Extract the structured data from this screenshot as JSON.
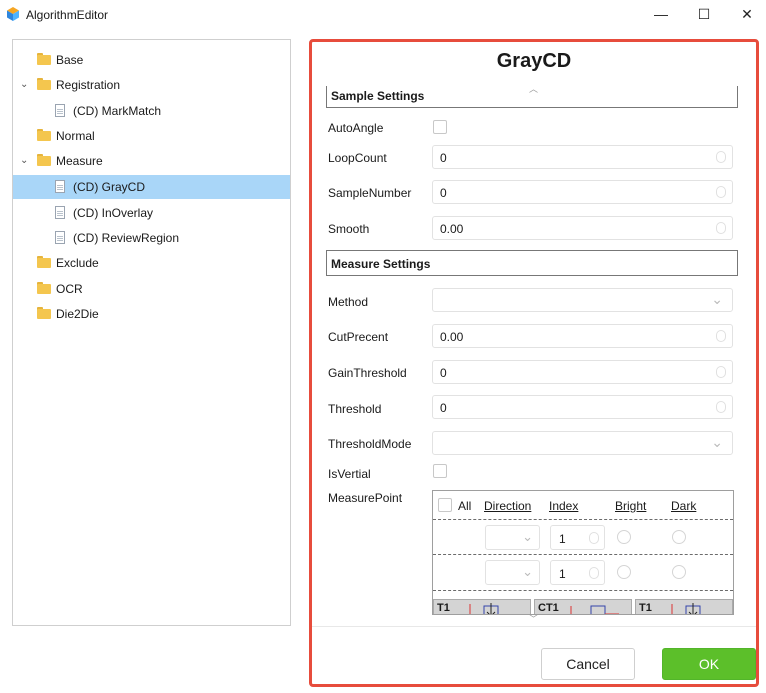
{
  "window": {
    "title": "AlgorithmEditor",
    "minimize": "—",
    "maximize": "☐",
    "close": "✕"
  },
  "tree": {
    "items": [
      {
        "label": "Base",
        "type": "folder",
        "level": 0,
        "expanded": false,
        "selected": false
      },
      {
        "label": "Registration",
        "type": "folder",
        "level": 0,
        "expanded": true,
        "selected": false
      },
      {
        "label": "(CD) MarkMatch",
        "type": "file",
        "level": 1,
        "selected": false
      },
      {
        "label": "Normal",
        "type": "folder",
        "level": 0,
        "expanded": false,
        "selected": false
      },
      {
        "label": "Measure",
        "type": "folder",
        "level": 0,
        "expanded": true,
        "selected": false
      },
      {
        "label": "(CD) GrayCD",
        "type": "file",
        "level": 1,
        "selected": true
      },
      {
        "label": "(CD) InOverlay",
        "type": "file",
        "level": 1,
        "selected": false
      },
      {
        "label": "(CD) ReviewRegion",
        "type": "file",
        "level": 1,
        "selected": false
      },
      {
        "label": "Exclude",
        "type": "folder",
        "level": 0,
        "expanded": false,
        "selected": false
      },
      {
        "label": "OCR",
        "type": "folder",
        "level": 0,
        "expanded": false,
        "selected": false
      },
      {
        "label": "Die2Die",
        "type": "folder",
        "level": 0,
        "expanded": false,
        "selected": false
      }
    ]
  },
  "panel": {
    "title": "GrayCD",
    "sample_section": "Sample Settings",
    "sample_fields": {
      "auto_angle": {
        "label": "AutoAngle",
        "checked": false
      },
      "loop_count": {
        "label": "LoopCount",
        "value": "0"
      },
      "sample_number": {
        "label": "SampleNumber",
        "value": "0"
      },
      "smooth": {
        "label": "Smooth",
        "value": "0.00"
      }
    },
    "measure_section": "Measure Settings",
    "measure_fields": {
      "method": {
        "label": "Method",
        "value": ""
      },
      "cut_precent": {
        "label": "CutPrecent",
        "value": "0.00"
      },
      "gain_threshold": {
        "label": "GainThreshold",
        "value": "0"
      },
      "threshold": {
        "label": "Threshold",
        "value": "0"
      },
      "threshold_mode": {
        "label": "ThresholdMode",
        "value": ""
      },
      "is_vertial": {
        "label": "IsVertial",
        "checked": false
      },
      "measure_point": {
        "label": "MeasurePoint"
      }
    },
    "measure_point_grid": {
      "columns": {
        "all": "All",
        "direction": "Direction",
        "index": "Index",
        "bright": "Bright",
        "dark": "Dark"
      },
      "rows": [
        {
          "index": "1"
        },
        {
          "index": "1"
        }
      ],
      "thumbnails": [
        "T1",
        "CT1",
        "T1"
      ]
    }
  },
  "buttons": {
    "cancel": "Cancel",
    "ok": "OK"
  },
  "colors": {
    "selection": "#a9d6f8",
    "panel_border": "#e74c3c",
    "ok_button": "#5cbf2a"
  },
  "icons": {
    "app": "app-cube-icon",
    "folder": "folder-icon",
    "file": "file-icon"
  }
}
